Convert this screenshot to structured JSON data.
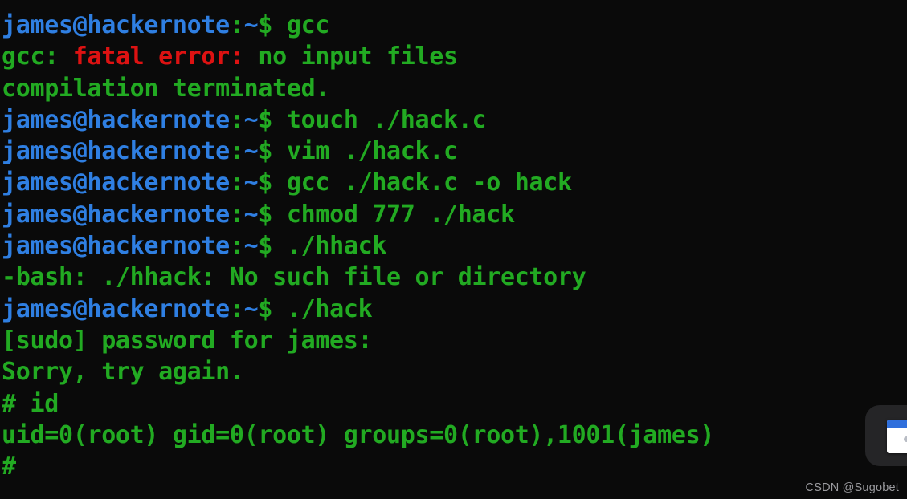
{
  "terminal": {
    "background_color": "#0a0a0a",
    "colors": {
      "prompt_user": "#2f7fe2",
      "prompt_punct": "#22aa22",
      "green": "#22aa22",
      "red": "#dd1212",
      "watermark": "#9a9a9e",
      "widget_panel": "#252527",
      "widget_titlebar": "#2f6fdc"
    },
    "prompt": {
      "user_host": "james@hackernote",
      "colon": ":",
      "path": "~",
      "sigil": "$"
    },
    "root_prompt": "#",
    "lines": [
      {
        "type": "clipped-prompt",
        "command": ""
      },
      {
        "type": "prompt",
        "command": "gcc"
      },
      {
        "type": "error",
        "pre": "gcc: ",
        "err": "fatal error:",
        "post": " no input files"
      },
      {
        "type": "output",
        "text": "compilation terminated."
      },
      {
        "type": "prompt",
        "command": "touch ./hack.c"
      },
      {
        "type": "prompt",
        "command": "vim ./hack.c"
      },
      {
        "type": "prompt",
        "command": "gcc ./hack.c -o hack"
      },
      {
        "type": "prompt",
        "command": "chmod 777 ./hack"
      },
      {
        "type": "prompt",
        "command": "./hhack"
      },
      {
        "type": "output",
        "text": "-bash: ./hhack: No such file or directory"
      },
      {
        "type": "prompt",
        "command": "./hack"
      },
      {
        "type": "output",
        "text": "[sudo] password for james:"
      },
      {
        "type": "output",
        "text": "Sorry, try again."
      },
      {
        "type": "root",
        "command": "id"
      },
      {
        "type": "output",
        "text": "uid=0(root) gid=0(root) groups=0(root),1001(james)"
      },
      {
        "type": "root",
        "command": ""
      }
    ]
  },
  "widget": {
    "icon_name": "window-app-icon"
  },
  "watermark": {
    "text": "CSDN @Sugobet"
  }
}
